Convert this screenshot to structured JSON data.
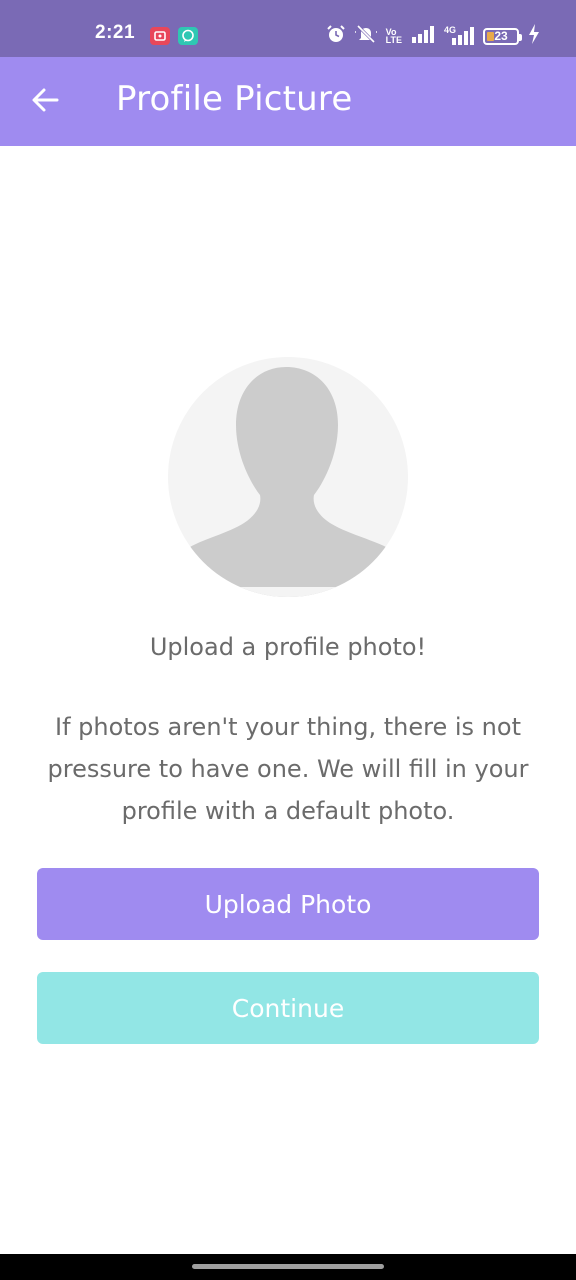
{
  "status_bar": {
    "time": "2:21",
    "network_label_top": "Vo",
    "network_label_bottom": "LTE",
    "network_4g": "4G",
    "battery_level": "23",
    "icons": [
      "screen-recorder-icon",
      "chat-app-icon",
      "alarm-icon",
      "muted-bell-icon",
      "volte-icon",
      "signal-icon",
      "signal-4g-icon",
      "battery-icon",
      "charging-bolt-icon"
    ]
  },
  "app_bar": {
    "title": "Profile Picture",
    "back_icon": "arrow-left-icon"
  },
  "main": {
    "avatar_icon": "person-silhouette-icon",
    "prompt": "Upload a profile photo!",
    "description": "If photos aren't your thing, there is not pressure to have one. We will fill in your profile with a default photo.",
    "upload_button_label": "Upload Photo",
    "continue_button_label": "Continue"
  },
  "colors": {
    "status_bar": "#7a6ab5",
    "app_bar": "#9f8bf0",
    "upload_button": "#9f8bf0",
    "continue_button": "#92e6e5",
    "text": "#6b6b6b",
    "avatar_background": "#f4f4f4",
    "silhouette": "#cccccc"
  }
}
